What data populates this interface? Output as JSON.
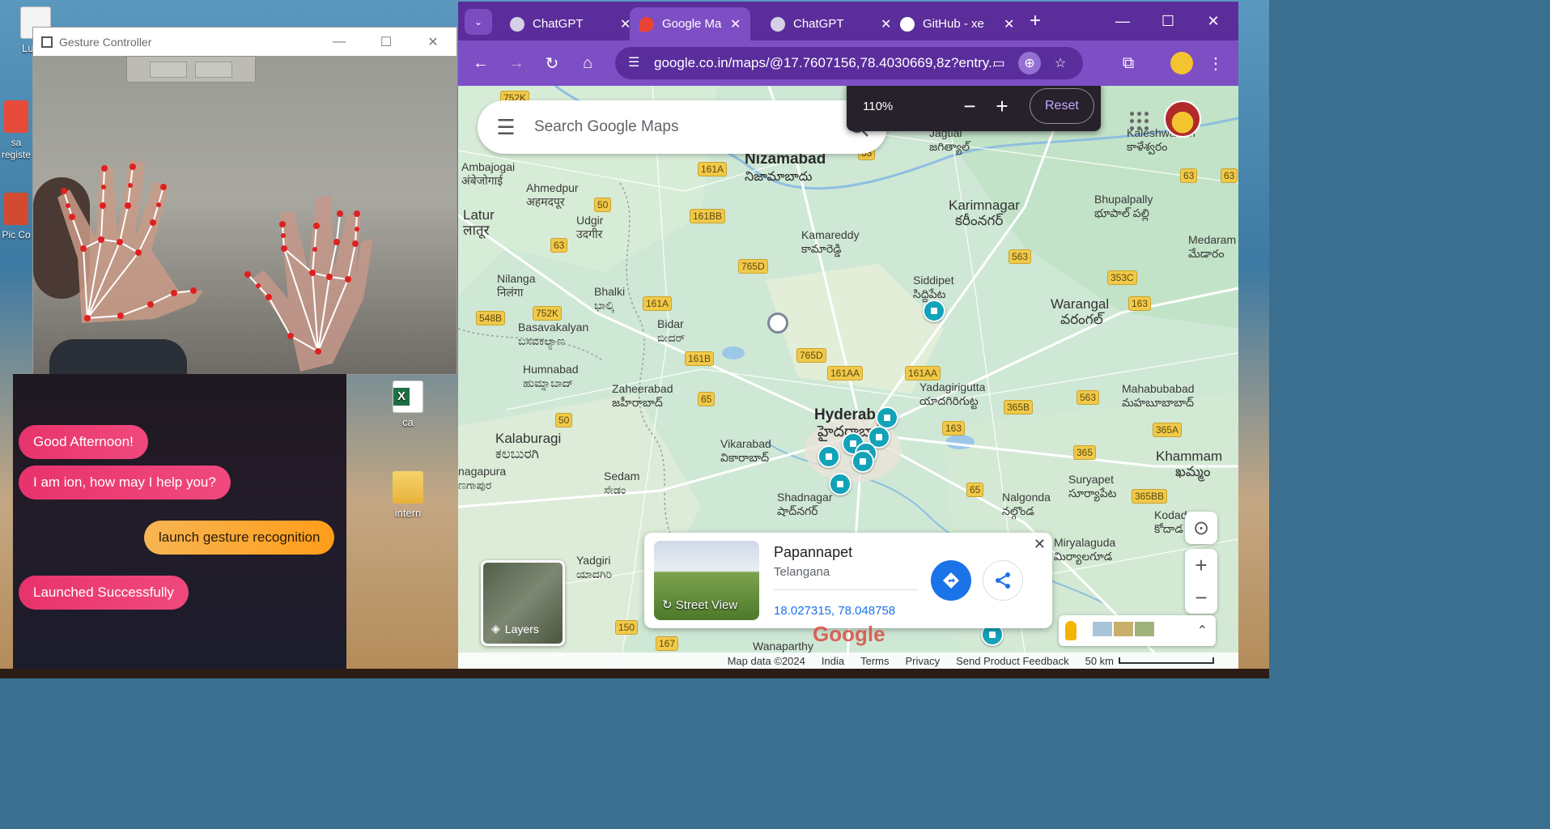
{
  "desktop": {
    "icons": [
      {
        "label": "Lucky"
      },
      {
        "label": "sa registe"
      },
      {
        "label": "Pic Co"
      },
      {
        "label": "ca"
      },
      {
        "label": "intern"
      }
    ]
  },
  "gesture_window": {
    "title": "Gesture Controller",
    "minimize": "—",
    "maximize": "☐",
    "close": "✕"
  },
  "chat": {
    "messages": [
      {
        "from": "bot",
        "text": "Good Afternoon!"
      },
      {
        "from": "bot",
        "text": "I am ion, how may I help you?"
      },
      {
        "from": "user",
        "text": "launch gesture recognition"
      },
      {
        "from": "bot",
        "text": "Launched Successfully"
      }
    ]
  },
  "browser": {
    "tabs": [
      {
        "label": "ChatGPT",
        "active": false
      },
      {
        "label": "Google Ma",
        "active": true
      },
      {
        "label": "ChatGPT",
        "active": false
      },
      {
        "label": "GitHub - xe",
        "active": false
      }
    ],
    "url": "google.co.in/maps/@17.7607156,78.4030669,8z?entry...",
    "zoom_popup": {
      "percent": "110%",
      "reset": "Reset"
    }
  },
  "map": {
    "search_placeholder": "Search Google Maps",
    "places": [
      {
        "name": "Nizamabad",
        "native": "నిజామాబాదు",
        "size": "big"
      },
      {
        "name": "Karimnagar",
        "native": "కరీంనగర్",
        "size": "mid"
      },
      {
        "name": "Hyderabad",
        "native": "హైదరాబాద్",
        "size": "big"
      },
      {
        "name": "Warangal",
        "native": "వరంగల్",
        "size": "mid"
      },
      {
        "name": "Latur",
        "native": "लातूर",
        "size": "mid"
      },
      {
        "name": "Kalaburagi",
        "native": "ಕಲಬುರಗಿ",
        "size": "mid"
      },
      {
        "name": "Khammam",
        "native": "ఖమ్మం",
        "size": "mid"
      },
      {
        "name": "Kamareddy",
        "native": "కామారెడ్డి",
        "size": "small"
      },
      {
        "name": "Siddipet",
        "native": "సిద్దిపేట",
        "size": "small"
      },
      {
        "name": "Ahmedpur",
        "native": "अहमदपूर",
        "size": "small"
      },
      {
        "name": "Udgir",
        "native": "उदगीर",
        "size": "small"
      },
      {
        "name": "Nilanga",
        "native": "निलंगा",
        "size": "small"
      },
      {
        "name": "Bhalki",
        "native": "ಭಾಲ್ಕಿ",
        "size": "small"
      },
      {
        "name": "Bidar",
        "native": "ಬೀದರ್",
        "size": "small"
      },
      {
        "name": "Basavakalyan",
        "native": "ಬಸವಕಲ್ಯಾಣ",
        "size": "small"
      },
      {
        "name": "Humnabad",
        "native": "ಹುಮ್ನಾಬಾದ್",
        "size": "small"
      },
      {
        "name": "Zaheerabad",
        "native": "జహీరాబాద్",
        "size": "small"
      },
      {
        "name": "Vikarabad",
        "native": "వికారాబాద్",
        "size": "small"
      },
      {
        "name": "Sedam",
        "native": "ಸೇಡಂ",
        "size": "small"
      },
      {
        "name": "Shadnagar",
        "native": "షాద్‌నగర్",
        "size": "small"
      },
      {
        "name": "Yadagirigutta",
        "native": "యాదగిరిగుట్ట",
        "size": "small"
      },
      {
        "name": "Mahabubabad",
        "native": "మహబూబాబాద్",
        "size": "small"
      },
      {
        "name": "Bhupalpally",
        "native": "భూపాల్‌ పల్లి",
        "size": "small"
      },
      {
        "name": "Suryapet",
        "native": "సూర్యాపేట",
        "size": "small"
      },
      {
        "name": "Nalgonda",
        "native": "నల్గొండ",
        "size": "small"
      },
      {
        "name": "Miryalaguda",
        "native": "మిర్యాలగూడ",
        "size": "small"
      },
      {
        "name": "Kodad",
        "native": "కోదాడ",
        "size": "small"
      },
      {
        "name": "Yadgiri",
        "native": "ಯಾದಗಿರಿ",
        "size": "small"
      },
      {
        "name": "Jagtial",
        "native": "జగిత్యాల్",
        "size": "small"
      },
      {
        "name": "Kaleshwaram",
        "native": "కాళేశ్వరం",
        "size": "small"
      },
      {
        "name": "Medaram",
        "native": "మేడారం",
        "size": "small"
      },
      {
        "name": "Ambajogai",
        "native": "अंबेजोगाई",
        "size": "small"
      },
      {
        "name": "nagapura",
        "native": "ಣಗಾಪುರ",
        "size": "small"
      },
      {
        "name": "Wanaparthy",
        "native": "",
        "size": "small"
      }
    ],
    "roads": [
      "752K",
      "161A",
      "161BB",
      "50",
      "63",
      "765D",
      "353C",
      "563",
      "163",
      "548B",
      "752K",
      "161A",
      "161B",
      "765D",
      "161AA",
      "161AA",
      "65",
      "50",
      "365B",
      "563",
      "163",
      "365A",
      "365",
      "65",
      "365BB",
      "63",
      "63",
      "150",
      "167",
      "63"
    ],
    "info_card": {
      "title": "Papannapet",
      "subtitle": "Telangana",
      "coords": "18.027315, 78.048758",
      "street_view": "Street View"
    },
    "layers_label": "Layers",
    "footer": {
      "map_data": "Map data ©2024",
      "country": "India",
      "terms": "Terms",
      "privacy": "Privacy",
      "feedback": "Send Product Feedback",
      "scale": "50 km"
    }
  }
}
